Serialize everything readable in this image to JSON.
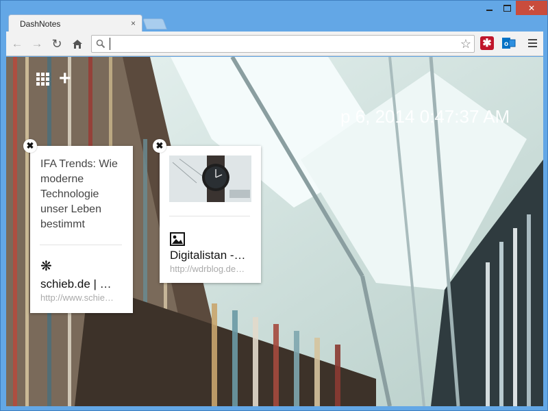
{
  "window": {
    "controls": {
      "minimize": "",
      "maximize": "",
      "close": "✕"
    }
  },
  "tabs": [
    {
      "title": "DashNotes",
      "close": "×"
    }
  ],
  "toolbar": {
    "back": "←",
    "forward": "→",
    "reload": "↻",
    "home": "⌂",
    "address_value": "",
    "address_placeholder": "",
    "star": "☆",
    "menu_label": ""
  },
  "page": {
    "clock_text": "p 6, 2014   0:47:37 AM",
    "add_icon": "+",
    "cards": [
      {
        "text": "IFA Trends: Wie moderne Technologie unser Leben bestimmt",
        "link_icon": "❋",
        "link_title": "schieb.de | …",
        "link_url": "http://www.schie…",
        "close": "✖"
      },
      {
        "thumb": "smartwatch-photo",
        "link_icon": "image-icon",
        "link_title": "Digitalistan -…",
        "link_url": "http://wdrblog.de…",
        "close": "✖"
      }
    ]
  },
  "icons": {
    "extension_1": "asterisk-extension-icon",
    "extension_2": "outlook-extension-icon"
  },
  "colors": {
    "titlebar": "#63a7e6",
    "close_button": "#c94c3c",
    "extension_1": "#c0162b",
    "extension_2": "#0072c6"
  }
}
